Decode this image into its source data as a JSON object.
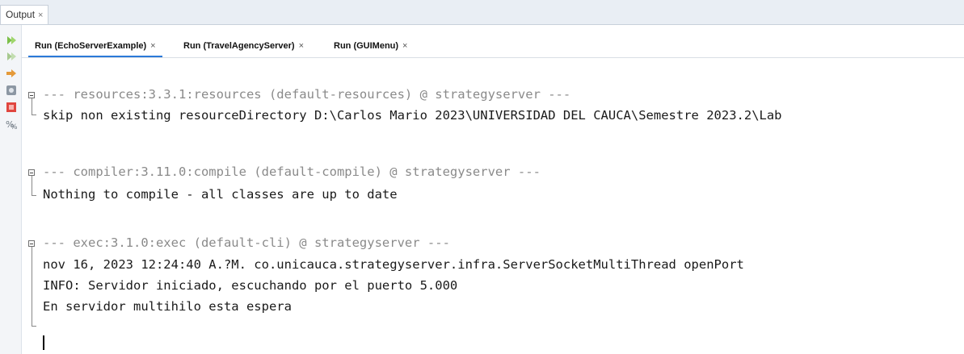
{
  "output_tab": {
    "label": "Output",
    "close": "×"
  },
  "run_tabs": [
    {
      "label": "Run (EchoServerExample)",
      "close": "×"
    },
    {
      "label": "Run (TravelAgencyServer)",
      "close": "×"
    },
    {
      "label": "Run (GUIMenu)",
      "close": "×"
    }
  ],
  "toolbar": {
    "icons": [
      "rerun-icon",
      "rerun-with-options-icon",
      "stop-arrow-icon",
      "settings-icon",
      "stop-icon",
      "clear-icon"
    ]
  },
  "console": {
    "lines": [
      "--- resources:3.3.1:resources (default-resources) @ strategyserver ---",
      "skip non existing resourceDirectory D:\\Carlos Mario 2023\\UNIVERSIDAD DEL CAUCA\\Semestre 2023.2\\Lab",
      "--- compiler:3.11.0:compile (default-compile) @ strategyserver ---",
      "Nothing to compile - all classes are up to date",
      "--- exec:3.1.0:exec (default-cli) @ strategyserver ---",
      "nov 16, 2023 12:24:40 A.?M. co.unicauca.strategyserver.infra.ServerSocketMultiThread openPort",
      "INFO: Servidor iniciado, escuchando por el puerto 5.000",
      "En servidor multihilo esta espera"
    ]
  },
  "colors": {
    "header_bg": "#e9eef4",
    "active_tab_underline": "#2b79d8",
    "gray_text": "#8a8a8a"
  }
}
